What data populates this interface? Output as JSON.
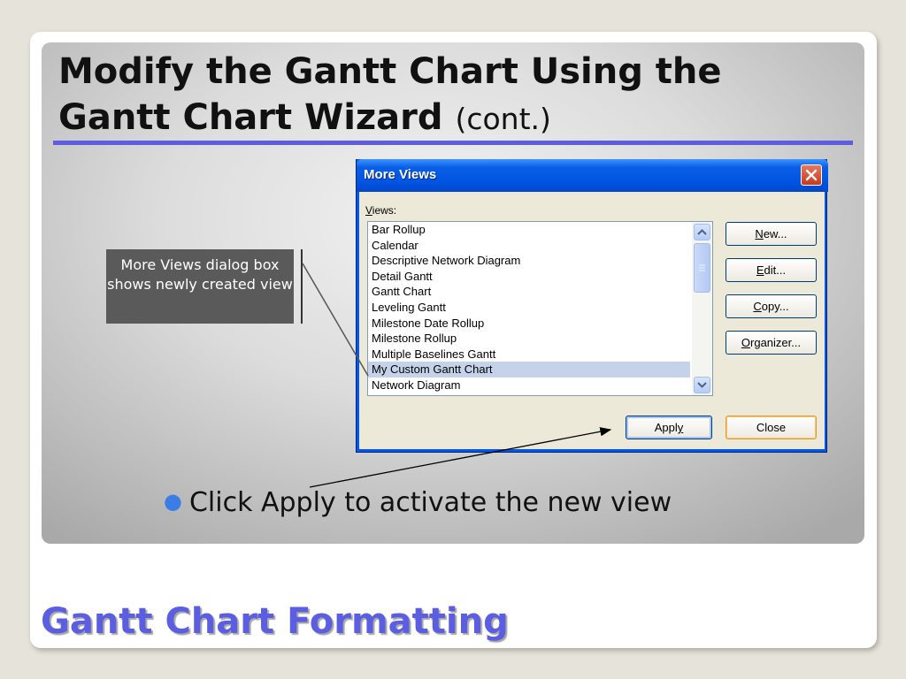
{
  "slide": {
    "title_main": "Modify the Gantt Chart Using the Gantt Chart Wizard",
    "title_suffix": "(cont.)",
    "callout_text": "More Views dialog box shows newly created view",
    "bullet_text": "Click Apply to activate the new view",
    "footer_title": "Gantt Chart Formatting"
  },
  "dialog": {
    "title": "More Views",
    "views_label_underlined": "V",
    "views_label_rest": "iews:",
    "items": [
      "Bar Rollup",
      "Calendar",
      "Descriptive Network Diagram",
      "Detail Gantt",
      "Gantt Chart",
      "Leveling Gantt",
      "Milestone Date Rollup",
      "Milestone Rollup",
      "Multiple Baselines Gantt",
      "My Custom Gantt Chart",
      "Network Diagram"
    ],
    "selected_item": "My Custom Gantt Chart",
    "buttons": {
      "new": {
        "u": "N",
        "rest": "ew..."
      },
      "edit": {
        "u": "E",
        "rest": "dit..."
      },
      "copy": {
        "u": "C",
        "rest": "opy..."
      },
      "organizer": {
        "u": "O",
        "rest": "rganizer..."
      },
      "apply": {
        "pre": "Appl",
        "u": "y"
      },
      "close": "Close"
    }
  },
  "colors": {
    "accent": "#5b5ee0",
    "selection": "#c5d3ea",
    "titlebar": "#0054e3",
    "bullet": "#3a7de6"
  }
}
